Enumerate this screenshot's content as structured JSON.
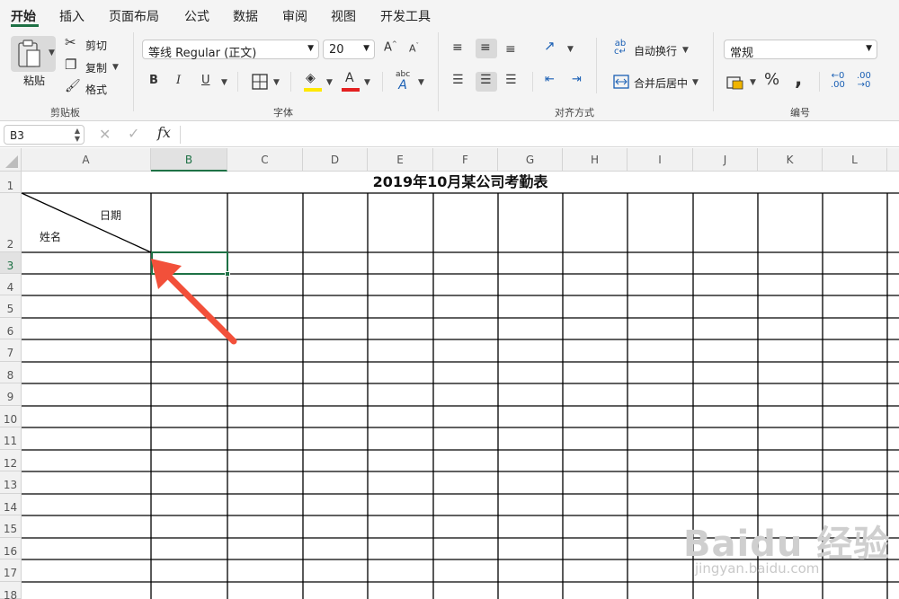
{
  "tabs": [
    "开始",
    "插入",
    "页面布局",
    "公式",
    "数据",
    "审阅",
    "视图",
    "开发工具"
  ],
  "ribbon": {
    "clipboard": {
      "paste": "粘贴",
      "cut": "剪切",
      "copy": "复制",
      "format": "格式",
      "group": "剪贴板"
    },
    "font": {
      "name": "等线 Regular (正文)",
      "size": "20",
      "group": "字体"
    },
    "alignment": {
      "wrap": "自动换行",
      "merge": "合并后居中",
      "group": "对齐方式"
    },
    "number": {
      "format": "常规",
      "group": "编号"
    }
  },
  "formula_bar": {
    "name_box": "B3",
    "fx": "fx",
    "value": ""
  },
  "columns": [
    "A",
    "B",
    "C",
    "D",
    "E",
    "F",
    "G",
    "H",
    "I",
    "J",
    "K",
    "L"
  ],
  "rows": [
    "1",
    "2",
    "3",
    "4",
    "5",
    "6",
    "7",
    "8",
    "9",
    "10",
    "11",
    "12",
    "13",
    "14",
    "15",
    "16",
    "17",
    "18"
  ],
  "sheet": {
    "title": "2019年10月某公司考勤表",
    "header_date": "日期",
    "header_name": "姓名"
  },
  "selected_cell": "B3",
  "accent_color": "#1e7145",
  "arrow_color": "#f2503a",
  "watermark": {
    "brand": "Baidu 经验",
    "url": "jingyan.baidu.com"
  }
}
